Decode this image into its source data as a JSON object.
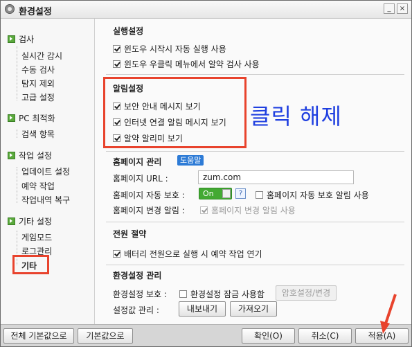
{
  "window": {
    "title": "환경설정",
    "min": "_",
    "close": "×"
  },
  "sidebar": {
    "groups": [
      {
        "label": "검사",
        "items": [
          "실시간 감시",
          "수동 검사",
          "탐지 제외",
          "고급 설정"
        ]
      },
      {
        "label": "PC 최적화",
        "items": [
          "검색 항목"
        ]
      },
      {
        "label": "작업 설정",
        "items": [
          "업데이트 설정",
          "예약 작업",
          "작업내역 복구"
        ]
      },
      {
        "label": "기타 설정",
        "items": [
          "게임모드",
          "로그관리",
          "기타"
        ]
      }
    ]
  },
  "execution": {
    "header": "실행설정",
    "options": [
      {
        "label": "윈도우 시작시 자동 실행 사용",
        "checked": true
      },
      {
        "label": "윈도우 우클릭 메뉴에서 알약 검사 사용",
        "checked": true
      }
    ]
  },
  "alerts": {
    "header": "알림설정",
    "options": [
      {
        "label": "보안 안내 메시지 보기",
        "checked": true
      },
      {
        "label": "인터넷 연결 알림 메시지 보기",
        "checked": true
      },
      {
        "label": "알약 알리미 보기",
        "checked": true
      }
    ]
  },
  "annotation": {
    "text": "클릭 해제",
    "color": "#1f3fe0",
    "highlight_color": "#e8432d"
  },
  "homepage": {
    "header": "홈페이지 관리",
    "help": "도움말",
    "url_label": "홈페이지 URL :",
    "url_value": "zum.com",
    "protect_label": "홈페이지 자동 보호 :",
    "toggle": "On",
    "toggle_state": "on",
    "help_q": "?",
    "protect_alert": {
      "label": "홈페이지 자동 보호 알림 사용",
      "checked": false
    },
    "change_label": "홈페이지 변경 알림 :",
    "change_alert": {
      "label": "홈페이지 변경 알림 사용",
      "checked": true,
      "disabled": true
    }
  },
  "power": {
    "header": "전원 절약",
    "option": {
      "label": "배터리 전원으로 실행 시 예약 작업 연기",
      "checked": true
    }
  },
  "envmgmt": {
    "header": "환경설정 관리",
    "protect_label": "환경설정 보호 :",
    "lock": {
      "label": "환경설정 잠금 사용함",
      "checked": false
    },
    "pw_button": "암호설정/변경",
    "manage_label": "설정값 관리 :",
    "export": "내보내기",
    "import": "가져오기"
  },
  "footer": {
    "reset_all": "전체 기본값으로",
    "reset": "기본값으로",
    "ok": "확인(O)",
    "cancel": "취소(C)",
    "apply": "적용(A)"
  },
  "accent_green": "#43a933",
  "accent_blue": "#2d7bd6"
}
